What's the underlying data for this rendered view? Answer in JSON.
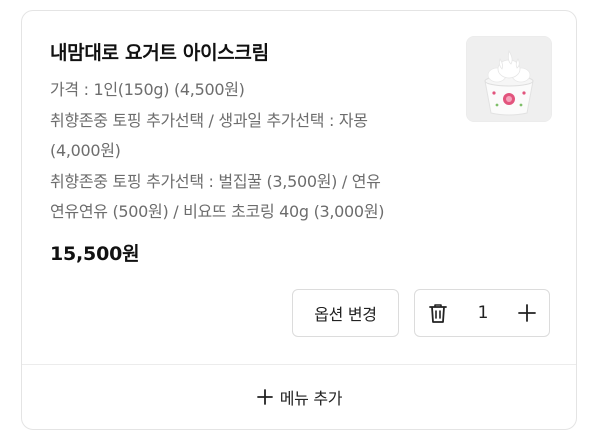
{
  "item": {
    "name": "내맘대로 요거트 아이스크림",
    "options": [
      "가격 : 1인(150g) (4,500원)",
      "취향존중 토핑 추가선택 / 생과일 추가선택 : 자몽",
      "(4,000원)",
      "취향존중 토핑 추가선택 : 벌집꿀 (3,500원) / 연유",
      "연유연유 (500원) / 비요뜨 초코링 40g (3,000원)"
    ],
    "price": "15,500원",
    "image_icon": "yogurt-ice-cream-cup"
  },
  "actions": {
    "change_option_label": "옵션 변경",
    "quantity": "1",
    "delete_icon": "trash-icon",
    "increase_icon": "plus-icon"
  },
  "footer": {
    "add_menu_label": "메뉴 추가",
    "add_icon": "plus-icon"
  }
}
